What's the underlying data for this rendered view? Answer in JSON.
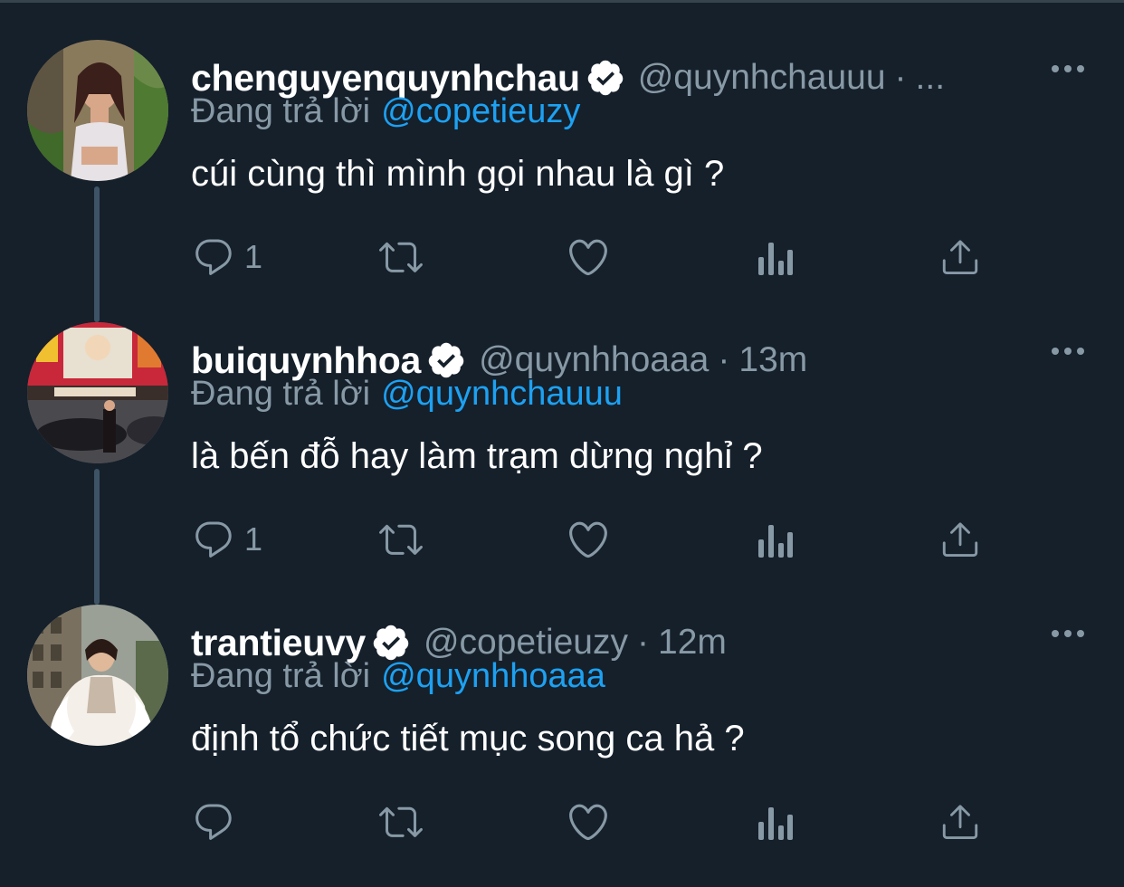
{
  "reply_prefix": "Đang trả lời",
  "tweets": [
    {
      "name": "chenguyenquynhchau",
      "handle": "@quynhchauuu",
      "separator": "·",
      "time": "...",
      "reply_to": "@copetieuzy",
      "text": "cúi cùng thì mình gọi nhau là gì ?",
      "reply_count": "1"
    },
    {
      "name": "buiquynhhoa",
      "handle": "@quynhhoaaa",
      "separator": "·",
      "time": "13m",
      "reply_to": "@quynhchauuu",
      "text": "là bến đỗ hay làm trạm dừng nghỉ ?",
      "reply_count": "1"
    },
    {
      "name": "trantieuvy",
      "handle": "@copetieuzy",
      "separator": "·",
      "time": "12m",
      "reply_to": "@quynhhoaaa",
      "text": "định tổ chức tiết mục song ca hả ?",
      "reply_count": ""
    }
  ],
  "icons": {
    "verified": "verified-badge-icon",
    "more": "more-dots-icon",
    "reply": "reply-bubble-icon",
    "retweet": "retweet-icon",
    "like": "heart-icon",
    "analytics": "analytics-bars-icon",
    "share": "share-upload-icon"
  },
  "colors": {
    "background": "#15202b",
    "secondary_text": "#8899a6",
    "link": "#1da1f2",
    "thread_line": "#3d5466"
  }
}
